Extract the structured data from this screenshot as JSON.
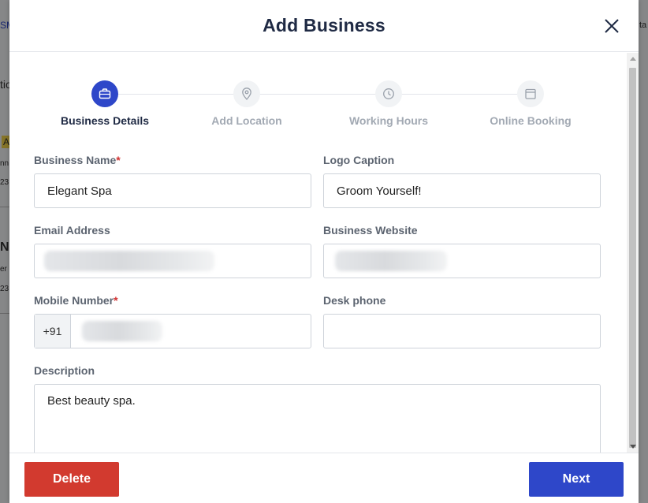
{
  "background": {
    "fragments": [
      "SM",
      "tio",
      "A",
      "nn",
      "23",
      "N",
      "er",
      "23",
      "ta"
    ]
  },
  "modal": {
    "title": "Add Business",
    "close_icon": "close-icon"
  },
  "stepper": {
    "steps": [
      {
        "label": "Business Details",
        "icon": "briefcase-icon",
        "state": "active"
      },
      {
        "label": "Add Location",
        "icon": "location-pin-icon",
        "state": "inactive"
      },
      {
        "label": "Working Hours",
        "icon": "clock-icon",
        "state": "inactive"
      },
      {
        "label": "Online Booking",
        "icon": "calendar-icon",
        "state": "inactive"
      }
    ]
  },
  "form": {
    "business_name": {
      "label": "Business Name",
      "required": "*",
      "value": "Elegant Spa"
    },
    "logo_caption": {
      "label": "Logo Caption",
      "value": "Groom Yourself!"
    },
    "email": {
      "label": "Email Address",
      "value": ""
    },
    "website": {
      "label": "Business Website",
      "value": ""
    },
    "mobile": {
      "label": "Mobile Number",
      "required": "*",
      "prefix": "+91",
      "value": ""
    },
    "desk_phone": {
      "label": "Desk phone",
      "value": ""
    },
    "description": {
      "label": "Description",
      "value": "Best beauty spa."
    }
  },
  "footer": {
    "delete_label": "Delete",
    "next_label": "Next"
  },
  "colors": {
    "primary": "#2e47c9",
    "danger": "#d23a2f",
    "required": "#d0302f"
  }
}
